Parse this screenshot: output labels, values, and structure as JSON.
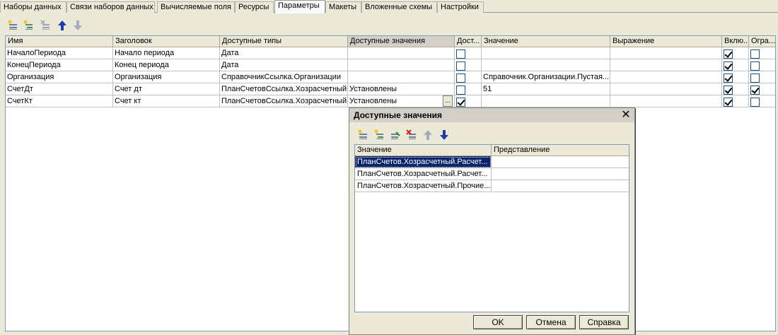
{
  "tabs": [
    {
      "label": "Наборы данных"
    },
    {
      "label": "Связи наборов данных"
    },
    {
      "label": "Вычисляемые поля"
    },
    {
      "label": "Ресурсы"
    },
    {
      "label": "Параметры"
    },
    {
      "label": "Макеты"
    },
    {
      "label": "Вложенные схемы"
    },
    {
      "label": "Настройки"
    }
  ],
  "active_tab": "Параметры",
  "toolbar": {
    "icons": [
      "add-row-icon",
      "add-child-row-icon",
      "delete-row-icon",
      "move-up-icon",
      "move-down-icon"
    ]
  },
  "grid": {
    "columns": [
      "Имя",
      "Заголовок",
      "Доступные типы",
      "Доступные значения",
      "Дост...",
      "Значение",
      "Выражение",
      "Вклю...",
      "Огра..."
    ],
    "rows": [
      {
        "name": "НачалоПериода",
        "title": "Начало периода",
        "types": "Дата",
        "values": "",
        "avail_checked": false,
        "value": "",
        "expression": "",
        "include_checked": true,
        "restrict_checked": false
      },
      {
        "name": "КонецПериода",
        "title": "Конец периода",
        "types": "Дата",
        "values": "",
        "avail_checked": false,
        "value": "",
        "expression": "",
        "include_checked": true,
        "restrict_checked": false
      },
      {
        "name": "Организация",
        "title": "Организация",
        "types": "СправочникСсылка.Организации",
        "values": "",
        "avail_checked": false,
        "value": "Справочник.Организации.Пустая...",
        "expression": "",
        "include_checked": true,
        "restrict_checked": false
      },
      {
        "name": "СчетДт",
        "title": "Счет дт",
        "types": "ПланСчетовСсылка.Хозрасчетный",
        "values": "Установлены",
        "avail_checked": false,
        "value": "51",
        "expression": "",
        "include_checked": true,
        "restrict_checked": true
      },
      {
        "name": "СчетКт",
        "title": "Счет кт",
        "types": "ПланСчетовСсылка.Хозрасчетный",
        "values": "Установлены",
        "avail_checked": true,
        "value": "",
        "expression": "",
        "include_checked": true,
        "restrict_checked": false
      }
    ],
    "ellipsis_label": "..."
  },
  "dialog": {
    "title": "Доступные значения",
    "close_glyph": "✕",
    "toolbar_icons": [
      "add-icon",
      "add-child-icon",
      "edit-icon",
      "delete-icon",
      "move-up-icon",
      "move-down-icon"
    ],
    "columns": [
      "Значение",
      "Представление"
    ],
    "rows": [
      {
        "value": "ПланСчетов.Хозрасчетный.Расчет...",
        "presentation": ""
      },
      {
        "value": "ПланСчетов.Хозрасчетный.Расчет...",
        "presentation": ""
      },
      {
        "value": "ПланСчетов.Хозрасчетный.Прочие...",
        "presentation": ""
      }
    ],
    "selected_row": 0,
    "buttons": {
      "ok": "OK",
      "cancel": "Отмена",
      "help": "Справка"
    }
  },
  "colors": {
    "selection": "#0a246a",
    "arrow_blue": "#1f3fa8"
  }
}
